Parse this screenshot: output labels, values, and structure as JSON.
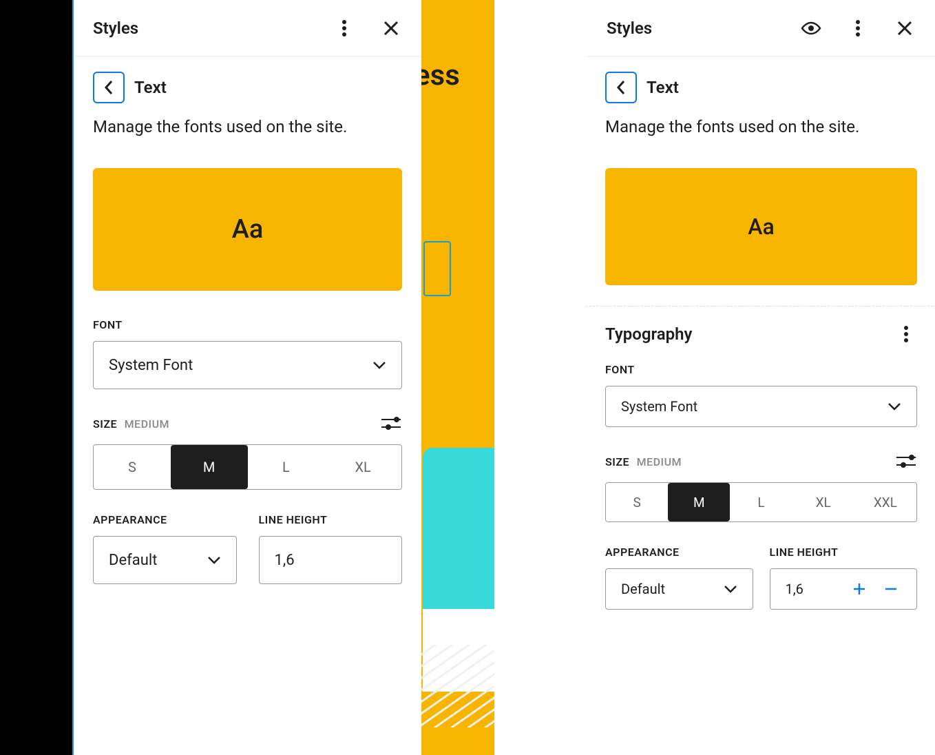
{
  "left": {
    "header": "Styles",
    "section_title": "Text",
    "description": "Manage the fonts used on the site.",
    "preview_text": "Aa",
    "font": {
      "label": "FONT",
      "value": "System Font"
    },
    "size": {
      "label": "SIZE",
      "value_label": "MEDIUM",
      "options": [
        "S",
        "M",
        "L",
        "XL"
      ],
      "active_index": 1
    },
    "appearance": {
      "label": "APPEARANCE",
      "value": "Default"
    },
    "line_height": {
      "label": "LINE HEIGHT",
      "value": "1,6"
    }
  },
  "gap": {
    "text_fragment": "ess"
  },
  "right": {
    "header": "Styles",
    "section_title": "Text",
    "description": "Manage the fonts used on the site.",
    "preview_text": "Aa",
    "typography_heading": "Typography",
    "font": {
      "label": "FONT",
      "value": "System Font"
    },
    "size": {
      "label": "SIZE",
      "value_label": "MEDIUM",
      "options": [
        "S",
        "M",
        "L",
        "XL",
        "XXL"
      ],
      "active_index": 1
    },
    "appearance": {
      "label": "APPEARANCE",
      "value": "Default"
    },
    "line_height": {
      "label": "LINE HEIGHT",
      "value": "1,6"
    }
  },
  "colors": {
    "accent": "#f7b500",
    "blue": "#0a7be6"
  }
}
